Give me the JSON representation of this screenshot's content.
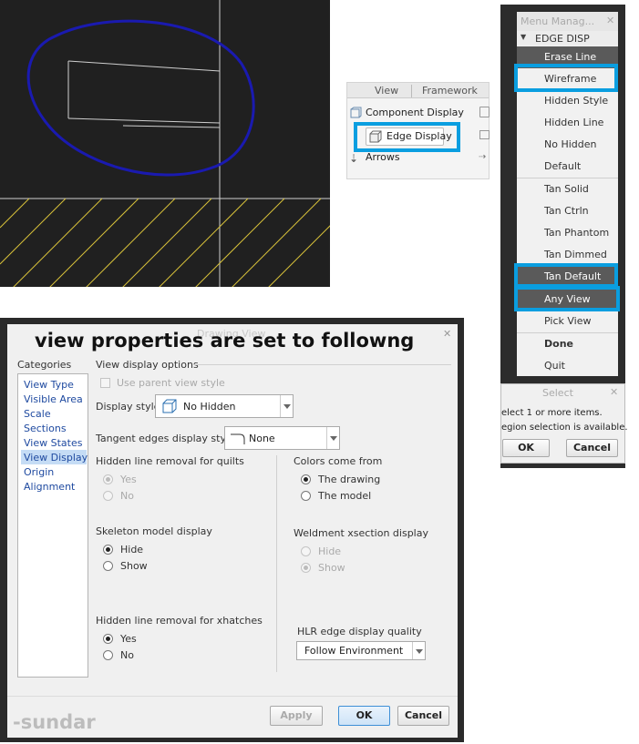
{
  "ribbon": {
    "tabs": [
      "View",
      "Framework"
    ],
    "buttons": [
      "Component Display",
      "Edge Display",
      "Arrows"
    ]
  },
  "menu_manager": {
    "title": "Menu Manag...",
    "section": "EDGE DISP",
    "items": [
      "Erase Line",
      "Wireframe",
      "Hidden Style",
      "Hidden Line",
      "No Hidden",
      "Default",
      "Tan Solid",
      "Tan Ctrln",
      "Tan Phantom",
      "Tan Dimmed",
      "Tan Default",
      "Any View",
      "Pick View",
      "Done",
      "Quit"
    ]
  },
  "select_dialog": {
    "title": "Select",
    "line1": "elect 1 or more items.",
    "line2": "egion selection is available.",
    "ok": "OK",
    "cancel": "Cancel"
  },
  "drawing_view": {
    "title": "Drawing View",
    "overlay": "view properties are set to followng",
    "categories_label": "Categories",
    "categories": [
      "View Type",
      "Visible Area",
      "Scale",
      "Sections",
      "View States",
      "View Display",
      "Origin",
      "Alignment"
    ],
    "selected_category": "View Display",
    "section_title": "View display options",
    "use_parent": "Use parent view style",
    "display_style_label": "Display style",
    "display_style_value": "No Hidden",
    "tangent_label": "Tangent edges display style",
    "tangent_value": "None",
    "hlr_quilts_label": "Hidden line removal for quilts",
    "hlr_quilts_options": [
      "Yes",
      "No"
    ],
    "skeleton_label": "Skeleton model display",
    "skeleton_options": [
      "Hide",
      "Show"
    ],
    "hlr_xhatch_label": "Hidden line removal for xhatches",
    "hlr_xhatch_options": [
      "Yes",
      "No"
    ],
    "colors_label": "Colors come from",
    "colors_options": [
      "The drawing",
      "The model"
    ],
    "weldment_label": "Weldment xsection display",
    "weldment_options": [
      "Hide",
      "Show"
    ],
    "hlr_quality_label": "HLR edge display quality",
    "hlr_quality_value": "Follow Environment",
    "apply": "Apply",
    "ok": "OK",
    "cancel": "Cancel",
    "watermark": "-sundar"
  },
  "colors": {
    "highlight": "#0a9ee0",
    "circle": "#1a1ab0",
    "hatch": "#d8c23a"
  }
}
